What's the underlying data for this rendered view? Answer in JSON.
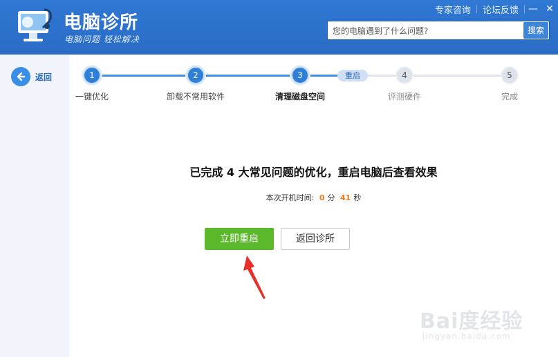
{
  "app": {
    "title": "电脑诊所",
    "slogan": "电脑问题 轻松解决"
  },
  "top_links": {
    "expert": "专家咨询",
    "forum": "论坛反馈",
    "minimize": "—",
    "close": "✕"
  },
  "search": {
    "placeholder": "您的电脑遇到了什么问题?",
    "button": "搜索"
  },
  "back": {
    "label": "返回"
  },
  "steps": [
    {
      "num": "1",
      "label": "一键优化",
      "state": "done"
    },
    {
      "num": "2",
      "label": "卸载不常用软件",
      "state": "done"
    },
    {
      "num": "3",
      "label": "清理磁盘空间",
      "state": "current"
    },
    {
      "num": "4",
      "label": "评测硬件",
      "state": "todo"
    },
    {
      "num": "5",
      "label": "完成",
      "state": "todo"
    }
  ],
  "substep_badge": "重启",
  "main": {
    "headline": "已完成 4 大常见问题的优化，重启电脑后查看效果",
    "boot_time": {
      "prefix": "本次开机时间:",
      "minutes": "0",
      "min_unit": "分",
      "seconds": "41",
      "sec_unit": "秒"
    },
    "restart_button": "立即重启",
    "return_button": "返回诊所"
  },
  "watermark": {
    "main": "Bai度经验",
    "sub": "jingyan.baidu.com"
  },
  "colors": {
    "header": "#2f78d4",
    "accent_green": "#5cb82b",
    "highlight_orange": "#f07b1a",
    "annotation_red": "#e8302a"
  }
}
